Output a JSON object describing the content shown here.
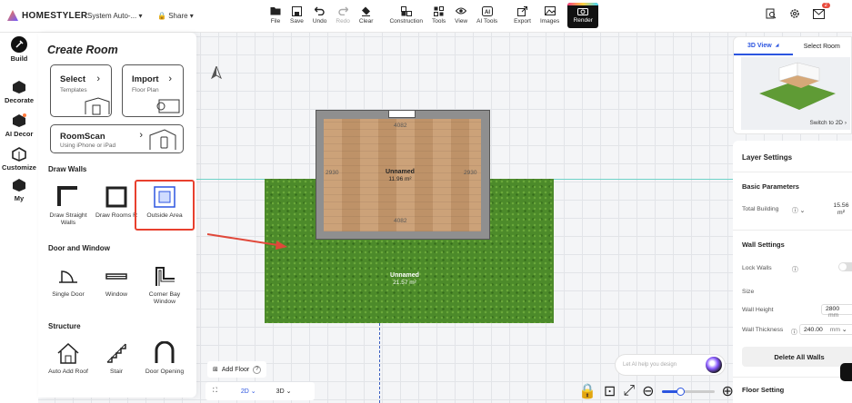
{
  "app": {
    "brand": "HOMESTYLER",
    "project": "System Auto-...",
    "share": "Share"
  },
  "toolbar": [
    {
      "label": "File",
      "icon": "folder-icon"
    },
    {
      "label": "Save",
      "icon": "save-icon"
    },
    {
      "label": "Undo",
      "icon": "undo-icon"
    },
    {
      "label": "Redo",
      "icon": "redo-icon",
      "disabled": true
    },
    {
      "label": "Clear",
      "icon": "eraser-icon"
    },
    {
      "label": "Construction",
      "icon": "construction-icon"
    },
    {
      "label": "Tools",
      "icon": "tools-icon"
    },
    {
      "label": "View",
      "icon": "eye-icon"
    },
    {
      "label": "AI Tools",
      "icon": "ai-icon"
    },
    {
      "label": "Export",
      "icon": "export-icon"
    },
    {
      "label": "Images",
      "icon": "image-icon"
    }
  ],
  "render_label": "Render",
  "notifications_count": "2",
  "rail": [
    {
      "label": "Build",
      "active": true
    },
    {
      "label": "Decorate"
    },
    {
      "label": "AI Decor"
    },
    {
      "label": "Customize"
    },
    {
      "label": "My"
    }
  ],
  "panel": {
    "title": "Create Room",
    "select": {
      "title": "Select",
      "sub": "Templates"
    },
    "import": {
      "title": "Import",
      "sub": "Floor Plan"
    },
    "roomscan": {
      "title": "RoomScan",
      "sub": "Using iPhone or iPad"
    },
    "sections": {
      "draw_walls": "Draw Walls",
      "door_window": "Door and Window",
      "structure": "Structure"
    },
    "draw_tools": [
      "Draw Straight Walls",
      "Draw Rooms R",
      "Outside Area"
    ],
    "door_tools": [
      "Single Door",
      "Window",
      "Corner Bay Window"
    ],
    "structure_tools": [
      "Auto Add Roof",
      "Stair",
      "Door Opening"
    ]
  },
  "plan": {
    "room1": {
      "name": "Unnamed",
      "area": "11.96 m²"
    },
    "room2": {
      "name": "Unnamed",
      "area": "21.57 m²"
    },
    "dims": {
      "top": "4082",
      "bottom": "4082",
      "left": "2930",
      "right": "2930"
    }
  },
  "right": {
    "tabs": [
      "3D View",
      "Select Room"
    ],
    "switch": "Switch to 2D",
    "layer_settings": "Layer Settings",
    "basic_params": "Basic Parameters",
    "total_building": "Total Building",
    "total_value": "15.56 m²",
    "wall_settings": "Wall Settings",
    "lock_walls": "Lock Walls",
    "size": "Size",
    "wall_height": "Wall Height",
    "wall_height_val": "2800",
    "wall_height_unit": "mm",
    "wall_thickness": "Wall Thickness",
    "wall_thickness_val": "240.00",
    "wall_thickness_unit": "mm",
    "delete_all": "Delete All Walls",
    "floor_setting": "Floor Setting"
  },
  "bottom": {
    "add_floor": "Add Floor",
    "view_2d": "2D",
    "view_3d": "3D",
    "ai_placeholder": "Let AI help you design",
    "zoom_level": 0.35
  },
  "colors": {
    "accent": "#2c55e0",
    "highlight": "#e8402e",
    "grass": "#4c8a2a",
    "wood": "#c89a6e"
  }
}
